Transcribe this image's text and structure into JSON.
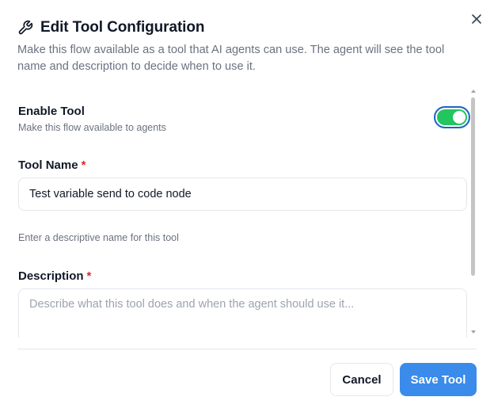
{
  "dialog": {
    "title": "Edit Tool Configuration",
    "subtitle": "Make this flow available as a tool that AI agents can use. The agent will see the tool name and description to decide when to use it.",
    "header_icon": "wrench-icon",
    "close_icon": "close-icon"
  },
  "enable_tool": {
    "label": "Enable Tool",
    "helper": "Make this flow available to agents",
    "enabled": true,
    "colors": {
      "on": "#22c55e",
      "focus_ring": "#1e63c9"
    }
  },
  "tool_name": {
    "label": "Tool Name",
    "required_marker": "*",
    "value": "Test variable send to code node",
    "helper": "Enter a descriptive name for this tool"
  },
  "description": {
    "label": "Description",
    "required_marker": "*",
    "value": "",
    "placeholder": "Describe what this tool does and when the agent should use it..."
  },
  "footer": {
    "cancel_label": "Cancel",
    "save_label": "Save Tool",
    "colors": {
      "primary": "#3b8beb"
    }
  }
}
